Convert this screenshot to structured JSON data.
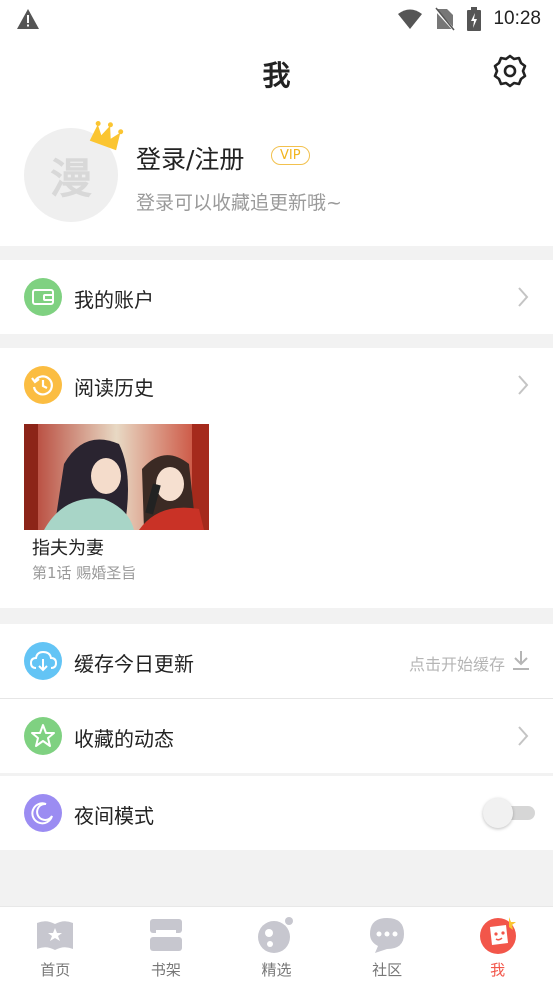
{
  "status_bar": {
    "time": "10:28"
  },
  "header": {
    "title": "我"
  },
  "profile": {
    "avatar_mark": "漫",
    "login_label": "登录/注册",
    "vip_badge": "VIP",
    "subtitle": "登录可以收藏追更新哦~"
  },
  "menu": {
    "account": {
      "label": "我的账户",
      "icon": "wallet-icon",
      "color": "#7fd181"
    },
    "history": {
      "label": "阅读历史",
      "icon": "clock-icon",
      "color": "#fbbd42"
    },
    "cache": {
      "label": "缓存今日更新",
      "hint": "点击开始缓存",
      "icon": "cloud-download-icon",
      "color": "#63c4f5"
    },
    "favorites": {
      "label": "收藏的动态",
      "icon": "star-icon",
      "color": "#7fd181"
    },
    "night_mode": {
      "label": "夜间模式",
      "icon": "moon-icon",
      "color": "#9b8cf2",
      "enabled": false
    }
  },
  "history_items": [
    {
      "title": "指夫为妻",
      "chapter": "第1话 赐婚圣旨"
    }
  ],
  "tabs": [
    {
      "label": "首页",
      "icon": "home-book-icon",
      "active": false
    },
    {
      "label": "书架",
      "icon": "bookshelf-icon",
      "active": false
    },
    {
      "label": "精选",
      "icon": "featured-icon",
      "active": false
    },
    {
      "label": "社区",
      "icon": "community-chat-icon",
      "active": false
    },
    {
      "label": "我",
      "icon": "me-icon",
      "active": true
    }
  ],
  "colors": {
    "accent": "#f2564a",
    "vip": "#f2b51e"
  }
}
